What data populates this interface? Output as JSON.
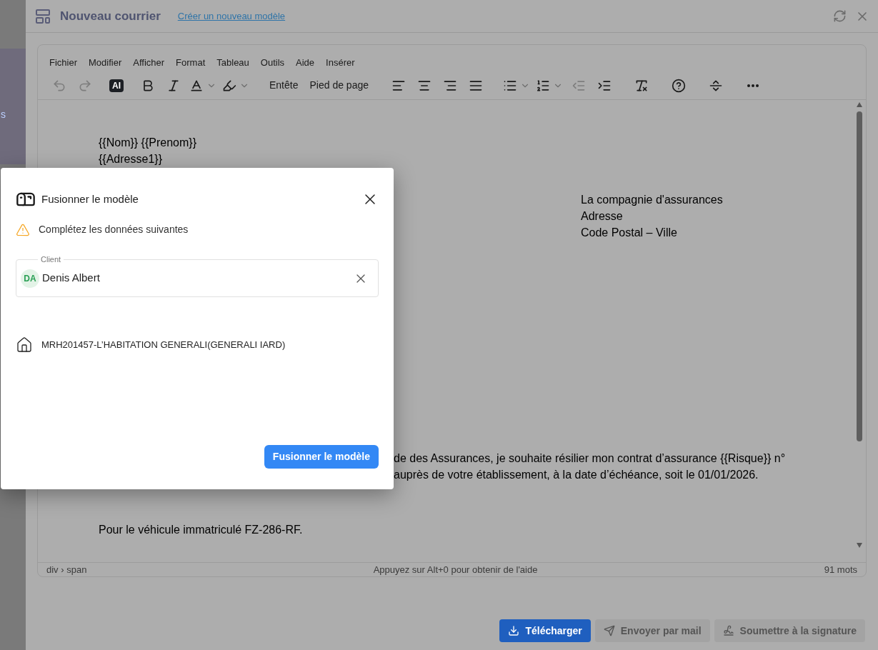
{
  "sidebar": {
    "fragment": "s"
  },
  "header": {
    "title": "Nouveau courrier",
    "link": "Créer un nouveau modèle"
  },
  "editor": {
    "menu": [
      "Fichier",
      "Modifier",
      "Afficher",
      "Format",
      "Tableau",
      "Outils",
      "Aide",
      "Insérer"
    ],
    "toolbar": [
      {
        "kind": "undo",
        "disabled": true
      },
      {
        "kind": "redo",
        "disabled": true
      },
      {
        "kind": "sep"
      },
      {
        "kind": "ai",
        "label": "AI"
      },
      {
        "kind": "sep"
      },
      {
        "kind": "bold"
      },
      {
        "kind": "italic"
      },
      {
        "kind": "textcolor"
      },
      {
        "kind": "highlight"
      },
      {
        "kind": "sep"
      },
      {
        "kind": "text",
        "label": "Entête"
      },
      {
        "kind": "text",
        "label": "Pied de page"
      },
      {
        "kind": "sep"
      },
      {
        "kind": "alignleft"
      },
      {
        "kind": "aligncenter"
      },
      {
        "kind": "alignright"
      },
      {
        "kind": "justify"
      },
      {
        "kind": "sep"
      },
      {
        "kind": "bullets"
      },
      {
        "kind": "numbers"
      },
      {
        "kind": "outdent",
        "disabled": true
      },
      {
        "kind": "indent"
      },
      {
        "kind": "sep"
      },
      {
        "kind": "clearformat"
      },
      {
        "kind": "sep"
      },
      {
        "kind": "help"
      },
      {
        "kind": "sep"
      },
      {
        "kind": "pagebreak"
      },
      {
        "kind": "sep"
      },
      {
        "kind": "more"
      }
    ],
    "address_lines": [
      "{{Nom}} {{Prenom}}",
      "{{Adresse1}}"
    ],
    "recipient_lines": [
      "La compagnie d'assurances",
      "Adresse",
      "Code Postal – Ville"
    ],
    "paragraph_lines": [
      "de des Assurances, je souhaite résilier mon contrat d’assurance {{Risque}} n°",
      "auprès de votre établissement, à la date d’échéance, soit le 01/01/2026."
    ],
    "vehicle_line": "Pour le véhicule immatriculé FZ-286-RF.",
    "status": {
      "path": "div › span",
      "help": "Appuyez sur Alt+0 pour obtenir de l'aide",
      "word_count": "91 mots"
    }
  },
  "actions": [
    {
      "label": "Télécharger",
      "kind": "download",
      "disabled": false
    },
    {
      "label": "Envoyer par mail",
      "kind": "mail",
      "disabled": true
    },
    {
      "label": "Soumettre à la signature",
      "kind": "sign",
      "disabled": true
    }
  ],
  "dialog": {
    "title": "Fusionner le modèle",
    "warning": "Complétez les données suivantes",
    "client_field": {
      "label": "Client",
      "initials": "DA",
      "value": "Denis Albert"
    },
    "contract": "MRH201457-L’HABITATION GENERALI(GENERALI IARD)",
    "submit": "Fusionner le modèle"
  }
}
